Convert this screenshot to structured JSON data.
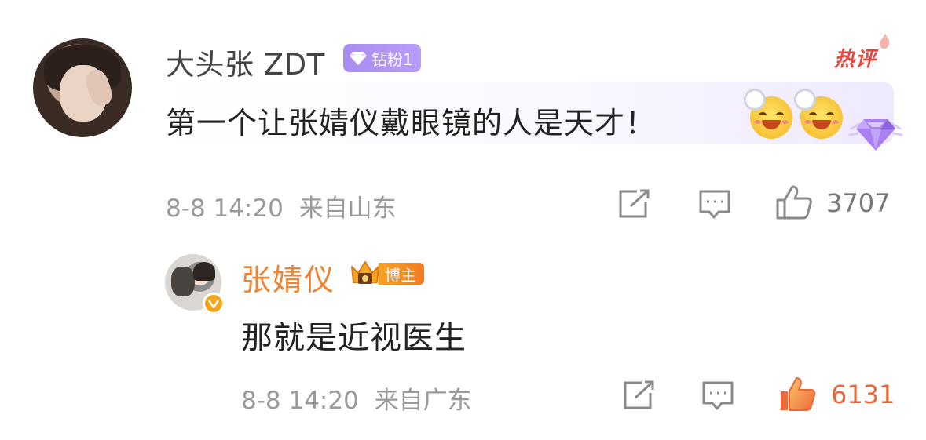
{
  "comment": {
    "username": "大头张 ZDT",
    "badge_label": "钻粉1",
    "hot_label": "热评",
    "text": "第一个让张婧仪戴眼镜的人是天才！",
    "emojis": [
      "smile-sweat-emoji",
      "smile-sweat-emoji"
    ],
    "time": "8-8 14:20",
    "location": "来自山东",
    "like_count": "3707"
  },
  "reply": {
    "username": "张婧仪",
    "badge_label": "博主",
    "text": "那就是近视医生",
    "time": "8-8 14:20",
    "location": "来自广东",
    "like_count": "6131"
  },
  "colors": {
    "diamond_badge": "#a98cf0",
    "hot": "#e8453c",
    "blogger_name": "#f08230",
    "liked": "#f07b3c",
    "meta_gray": "#9a9a9a"
  },
  "icons": [
    "share-icon",
    "comment-icon",
    "like-icon",
    "diamond-icon",
    "crown-icon",
    "verified-icon",
    "flame-icon"
  ]
}
